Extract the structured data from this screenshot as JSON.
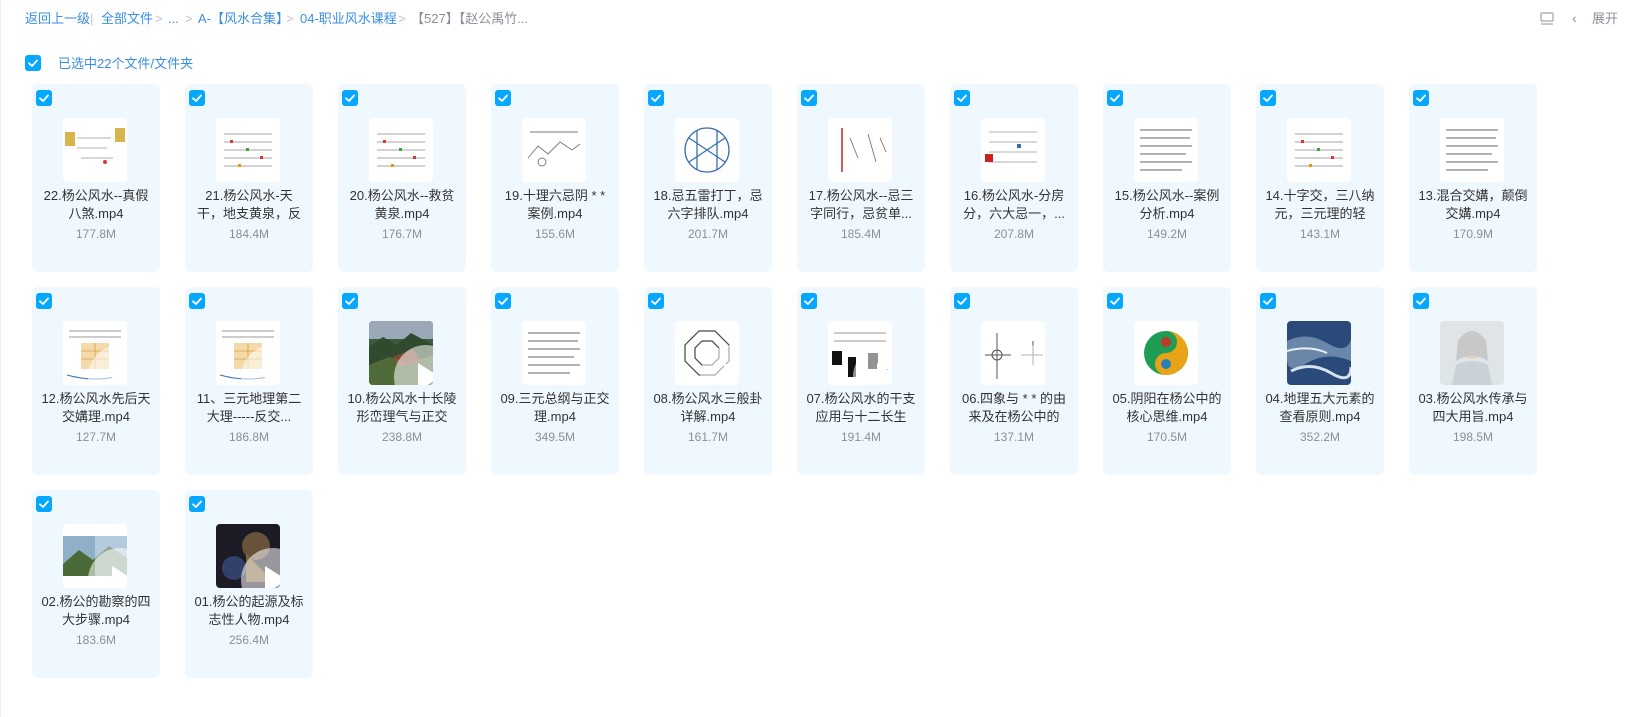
{
  "breadcrumb": {
    "back": "返回上一级",
    "root": "全部文件",
    "ellipsis": "...",
    "level1": "A-【风水合集】",
    "level2": "04-职业风水课程",
    "current": "【527】【赵公禹竹..."
  },
  "toolbar": {
    "view_icon": "list-view-icon",
    "expand_label": "展开"
  },
  "selection": {
    "label": "已选中22个文件/文件夹"
  },
  "colors": {
    "accent": "#06a7ff",
    "link": "#3a8ee6",
    "card_bg": "#f0f8ff",
    "muted_text": "#8a8f99"
  },
  "files": [
    {
      "name": "22.杨公风水--真假八煞.mp4",
      "size": "177.8M",
      "thumb": "doc-yellow"
    },
    {
      "name": "21.杨公风水-天干，地支黄泉，反",
      "size": "184.4M",
      "thumb": "doc-colored"
    },
    {
      "name": "20.杨公风水--救贫黄泉.mp4",
      "size": "176.7M",
      "thumb": "doc-colored"
    },
    {
      "name": "19.十理六忌阴 * * 案例.mp4",
      "size": "155.6M",
      "thumb": "doc-diagram"
    },
    {
      "name": "18.忌五雷打丁，忌六字排队.mp4",
      "size": "201.7M",
      "thumb": "doc-grid"
    },
    {
      "name": "17.杨公风水--忌三字同行，忌贫单...",
      "size": "185.4M",
      "thumb": "doc-diagram-red"
    },
    {
      "name": "16.杨公风水-分房分，六大忌一，...",
      "size": "207.8M",
      "thumb": "doc-table-red"
    },
    {
      "name": "15.杨公风水--案例分析.mp4",
      "size": "149.2M",
      "thumb": "doc-text"
    },
    {
      "name": "14.十字交，三八纳元，三元理的轻",
      "size": "143.1M",
      "thumb": "doc-colored"
    },
    {
      "name": "13.混合交媾，颠倒交媾.mp4",
      "size": "170.9M",
      "thumb": "doc-text"
    },
    {
      "name": "12.杨公风水先后天交媾理.mp4",
      "size": "127.7M",
      "thumb": "doc-chart"
    },
    {
      "name": "11、三元地理第二大理-----反交...",
      "size": "186.8M",
      "thumb": "doc-chart"
    },
    {
      "name": "10.杨公风水十长陵形峦理气与正交",
      "size": "238.8M",
      "thumb": "video-mountain"
    },
    {
      "name": "09.三元总纲与正交理.mp4",
      "size": "349.5M",
      "thumb": "doc-text"
    },
    {
      "name": "08.杨公风水三般卦详解.mp4",
      "size": "161.7M",
      "thumb": "doc-octagon"
    },
    {
      "name": "07.杨公风水的干支应用与十二长生",
      "size": "191.4M",
      "thumb": "doc-blocks"
    },
    {
      "name": "06.四象与 * * 的由来及在杨公中的",
      "size": "137.1M",
      "thumb": "doc-cross"
    },
    {
      "name": "05.阴阳在杨公中的核心思维.mp4",
      "size": "170.5M",
      "thumb": "taiji"
    },
    {
      "name": "04.地理五大元素的查看原则.mp4",
      "size": "352.2M",
      "thumb": "photo-aerial"
    },
    {
      "name": "03.杨公风水传承与四大用旨.mp4",
      "size": "198.5M",
      "thumb": "photo-portrait"
    },
    {
      "name": "02.杨公的勘察的四大步骤.mp4",
      "size": "183.6M",
      "thumb": "video-landscape"
    },
    {
      "name": "01.杨公的起源及标志性人物.mp4",
      "size": "256.4M",
      "thumb": "video-dark"
    }
  ]
}
